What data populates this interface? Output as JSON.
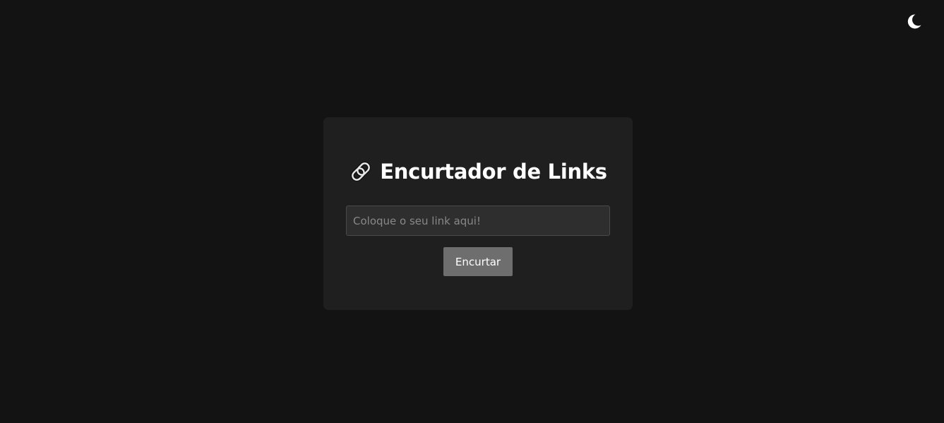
{
  "theme_toggle": {
    "icon": "moon-icon",
    "color": "#ffffff"
  },
  "card": {
    "title_icon": "link-icon",
    "title": "Encurtador de Links",
    "input": {
      "value": "",
      "placeholder": "Coloque o seu link aqui!"
    },
    "submit_label": "Encurtar"
  },
  "colors": {
    "background": "#131313",
    "card": "#1f1f1f",
    "input_background": "#2e2e2e",
    "button": "#6e6e6e",
    "text": "#ffffff"
  }
}
